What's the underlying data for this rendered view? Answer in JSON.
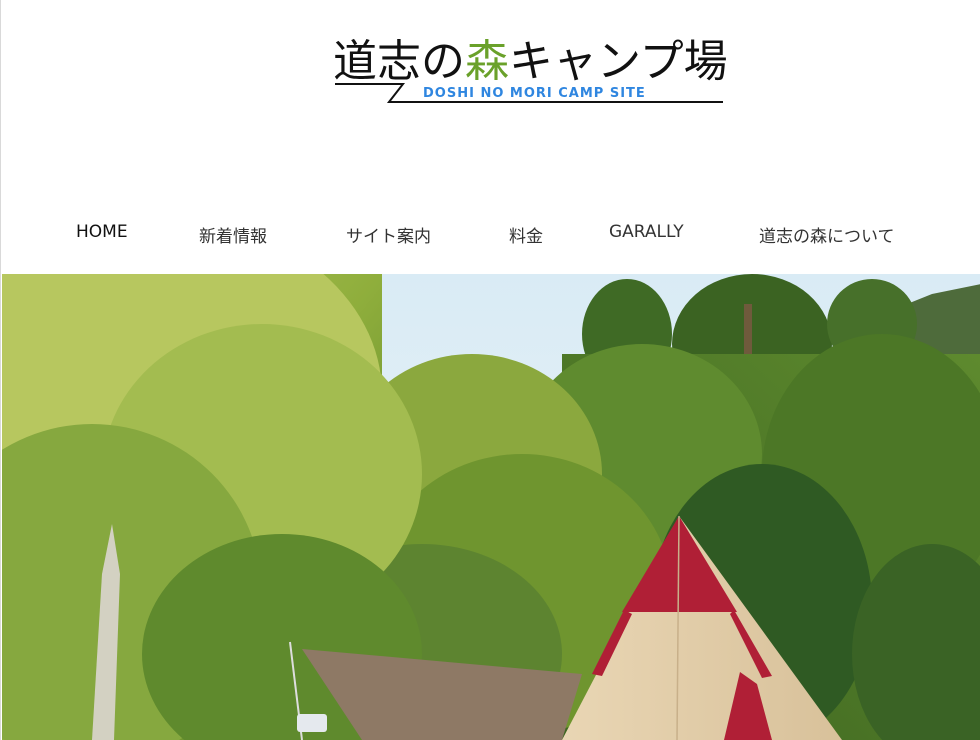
{
  "logo": {
    "title_part1": "道志の",
    "title_highlight": "森",
    "title_part2": "キャンプ場",
    "subtitle": "DOSHI NO MORI CAMP SITE"
  },
  "nav": {
    "items": [
      {
        "label": "HOME",
        "active": true
      },
      {
        "label": "新着情報",
        "active": false
      },
      {
        "label": "サイト案内",
        "active": false
      },
      {
        "label": "料金",
        "active": false
      },
      {
        "label": "GARALLY",
        "active": false
      },
      {
        "label": "道志の森について",
        "active": false
      }
    ]
  },
  "colors": {
    "logo_green": "#6aa12a",
    "logo_blue": "#2f86e0",
    "text": "#333333"
  }
}
